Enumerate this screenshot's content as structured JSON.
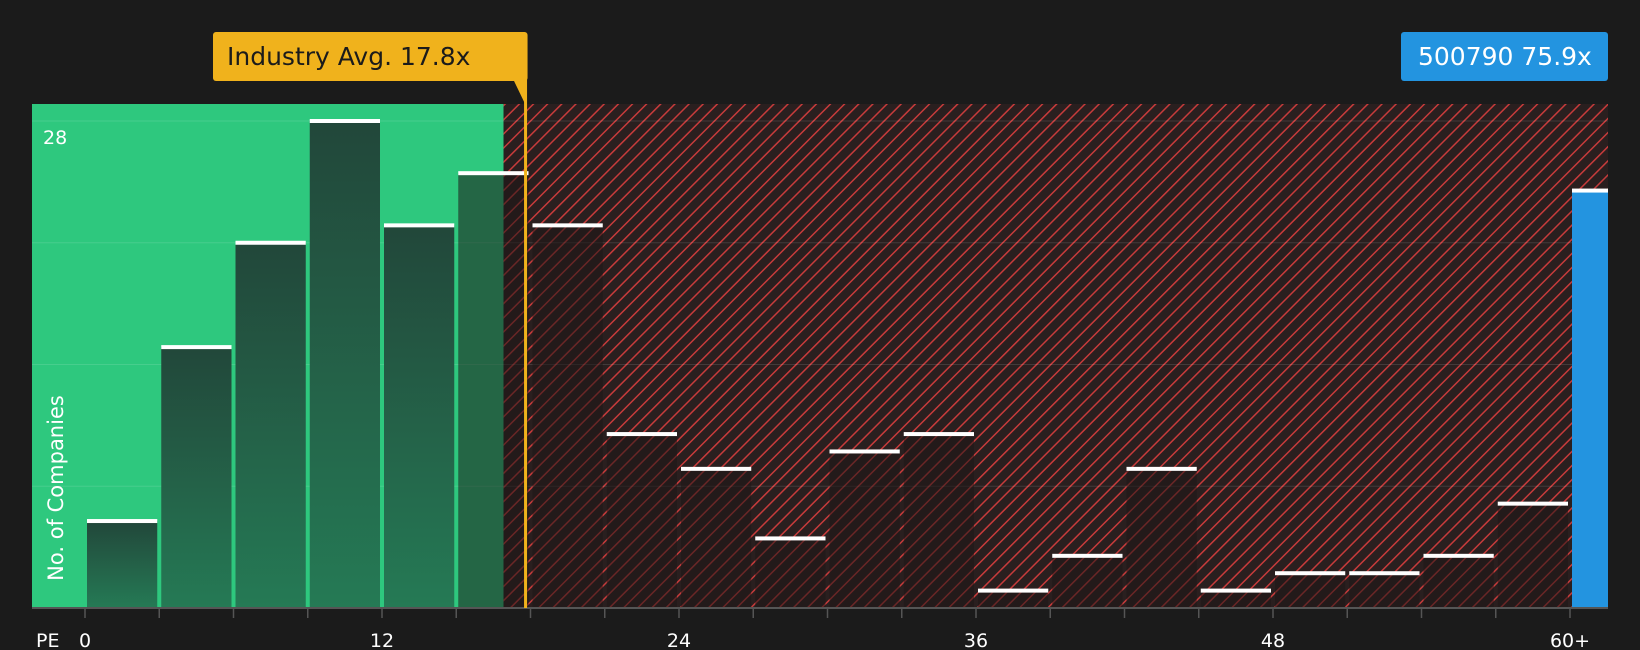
{
  "chart_data": {
    "type": "bar",
    "xlabel": "PE",
    "ylabel": "No. of Companies",
    "x_tick_labels": [
      "0",
      "12",
      "24",
      "36",
      "48",
      "60+"
    ],
    "x_tick_values": [
      0,
      12,
      24,
      36,
      48,
      60
    ],
    "xlim": [
      0,
      61.5
    ],
    "ylim": [
      0,
      29
    ],
    "y_tick_label": "28",
    "bin_width": 3,
    "bins": [
      {
        "start": 0,
        "value": 5
      },
      {
        "start": 3,
        "value": 15
      },
      {
        "start": 6,
        "value": 21
      },
      {
        "start": 9,
        "value": 28
      },
      {
        "start": 12,
        "value": 22
      },
      {
        "start": 15,
        "value": 25
      },
      {
        "start": 18,
        "value": 22
      },
      {
        "start": 21,
        "value": 10
      },
      {
        "start": 24,
        "value": 8
      },
      {
        "start": 27,
        "value": 4
      },
      {
        "start": 30,
        "value": 9
      },
      {
        "start": 33,
        "value": 10
      },
      {
        "start": 36,
        "value": 1
      },
      {
        "start": 39,
        "value": 3
      },
      {
        "start": 42,
        "value": 8
      },
      {
        "start": 45,
        "value": 1
      },
      {
        "start": 48,
        "value": 2
      },
      {
        "start": 51,
        "value": 2
      },
      {
        "start": 54,
        "value": 3
      },
      {
        "start": 57,
        "value": 6
      }
    ],
    "company_bar": {
      "start": 60,
      "end": 61.5,
      "value": 24
    },
    "industry_avg": {
      "label": "Industry Avg. 17.8x",
      "value": 17.8
    },
    "company": {
      "label": "500790 75.9x"
    },
    "grid": true,
    "colors": {
      "background": "#1b1b1b",
      "good_zone": "#2ec87e",
      "bad_zone_hatch": "#c73b3b",
      "bar_dark": "#234a39",
      "bar_bad": "#2a2222",
      "avg_line": "#f0b21c",
      "company": "#2394e0",
      "bar_top": "#ffffff"
    }
  }
}
